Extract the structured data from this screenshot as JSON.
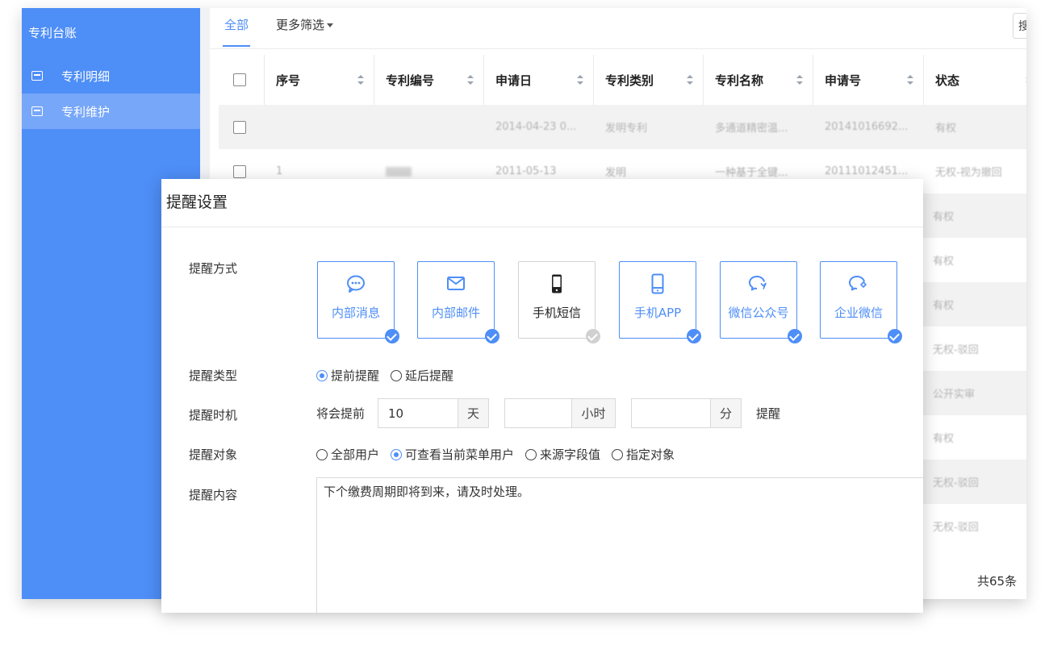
{
  "sidebar": {
    "title": "专利台账",
    "items": [
      {
        "label": "专利明细"
      },
      {
        "label": "专利维护"
      }
    ]
  },
  "tabs": [
    {
      "label": "全部"
    },
    {
      "label": "更多筛选"
    }
  ],
  "search": {
    "visible_text": "搜"
  },
  "table": {
    "headers": [
      "序号",
      "专利编号",
      "申请日",
      "专利类别",
      "专利名称",
      "申请号",
      "状态"
    ],
    "rows": [
      {
        "index": "",
        "number": "",
        "date": "2014-04-23 0...",
        "category": "发明专利",
        "name": "多通道精密温...",
        "app_no": "20141016692...",
        "status": "有权"
      },
      {
        "index": "1",
        "number": "",
        "date": "2011-05-13",
        "category": "发明",
        "name": "一种基于全键...",
        "app_no": "20111012451...",
        "status": "无权-视为撤回"
      }
    ],
    "status_column_rest": [
      "有权",
      "有权",
      "有权",
      "无权-驳回",
      "公开实审",
      "有权",
      "无权-驳回",
      "无权-驳回"
    ],
    "total": "共65条"
  },
  "modal": {
    "title": "提醒设置",
    "method_label": "提醒方式",
    "methods": [
      {
        "label": "内部消息",
        "icon": "chat-bubble-icon",
        "checked": true
      },
      {
        "label": "内部邮件",
        "icon": "mail-icon",
        "checked": true
      },
      {
        "label": "手机短信",
        "icon": "phone-icon",
        "checked": false
      },
      {
        "label": "手机APP",
        "icon": "mobile-app-icon",
        "checked": true
      },
      {
        "label": "微信公众号",
        "icon": "wechat-icon",
        "checked": true
      },
      {
        "label": "企业微信",
        "icon": "wecom-icon",
        "checked": true
      }
    ],
    "type_label": "提醒类型",
    "types": [
      {
        "label": "提前提醒",
        "selected": true
      },
      {
        "label": "延后提醒",
        "selected": false
      }
    ],
    "timing_label": "提醒时机",
    "timing": {
      "prefix": "将会提前",
      "days_value": "10",
      "days_unit": "天",
      "hours_value": "",
      "hours_unit": "小时",
      "minutes_value": "",
      "minutes_unit": "分",
      "suffix": "提醒"
    },
    "target_label": "提醒对象",
    "targets": [
      {
        "label": "全部用户",
        "selected": false
      },
      {
        "label": "可查看当前菜单用户",
        "selected": true
      },
      {
        "label": "来源字段值",
        "selected": false
      },
      {
        "label": "指定对象",
        "selected": false
      }
    ],
    "content_label": "提醒内容",
    "content_value": "下个缴费周期即将到来，请及时处理。"
  },
  "colors": {
    "accent": "#4e8ef7",
    "sidebar": "#4e8ef7",
    "sidebar_active": "#77a7f8"
  }
}
